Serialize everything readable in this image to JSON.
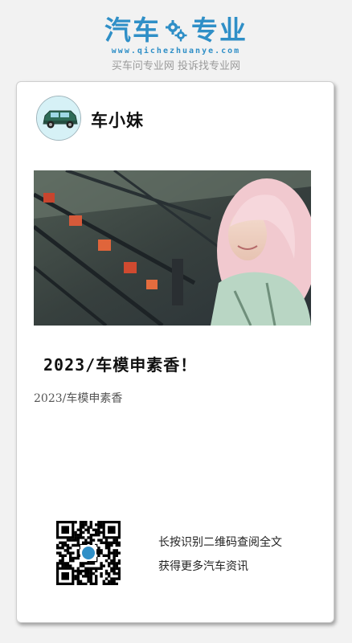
{
  "brand": {
    "name_left": "汽车",
    "name_right": "专业",
    "url": "www.qichezhuanye.com",
    "slogan": "买车问专业网 投诉找专业网",
    "brand_color": "#2f8fc7",
    "gear_icon": "gear-icon"
  },
  "post": {
    "author": "车小妹",
    "avatar_icon": "car-avatar-icon",
    "title": "2023/车模申素香！",
    "summary": "2023/车模申素香"
  },
  "footer": {
    "qr_icon": "qr-code-icon",
    "tip_line1": "长按识别二维码查阅全文",
    "tip_line2": "获得更多汽车资讯"
  }
}
